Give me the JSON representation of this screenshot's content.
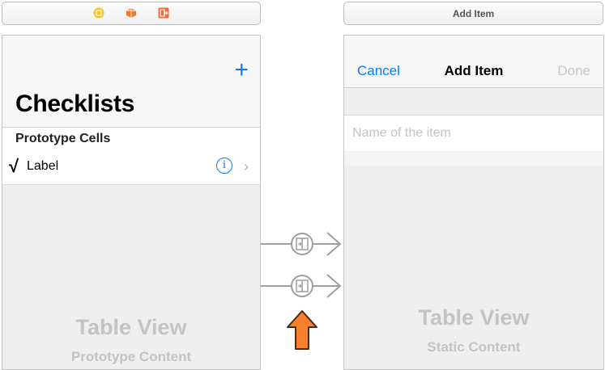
{
  "left_scene": {
    "nav": {
      "add_icon": "plus-icon",
      "large_title": "Checklists"
    },
    "section_header": "Prototype Cells",
    "cell": {
      "checkmark": "√",
      "label": "Label",
      "info_glyph": "i",
      "disclosure": "›"
    },
    "watermark_title": "Table View",
    "watermark_subtitle": "Prototype Content"
  },
  "right_scene": {
    "bar_title": "Add Item",
    "nav": {
      "cancel": "Cancel",
      "title": "Add Item",
      "done": "Done"
    },
    "text_field": {
      "placeholder": "Name of the item",
      "value": ""
    },
    "watermark_title": "Table View",
    "watermark_subtitle": "Static Content"
  },
  "colors": {
    "accent": "#0a7aff",
    "segue_gray": "#9e9e9e",
    "arrow_orange": "#f77f2e",
    "watermark": "#c3c3c3"
  },
  "icons": [
    "view-controller-icon",
    "first-responder-icon",
    "exit-icon",
    "segue-icon",
    "highlight-arrow-icon"
  ]
}
